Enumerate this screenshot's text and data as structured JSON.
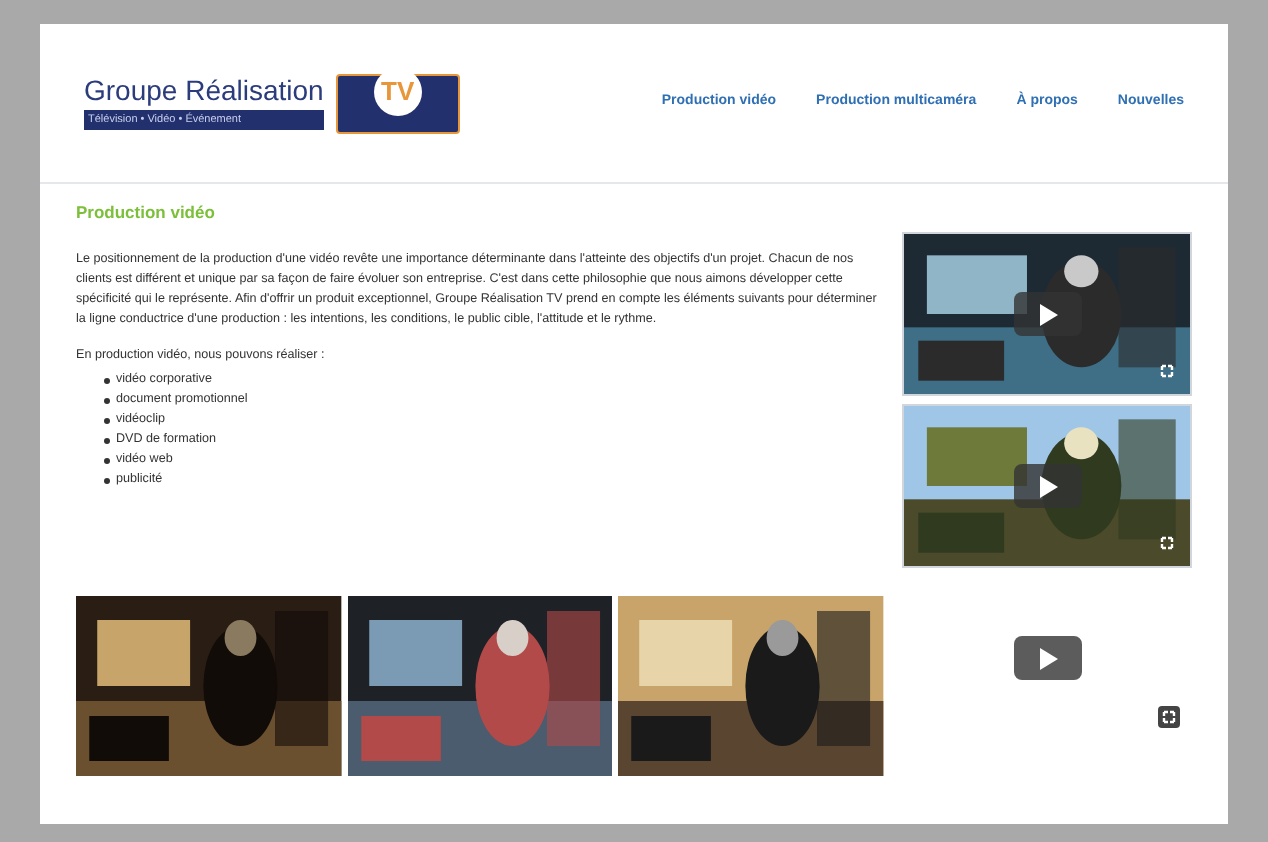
{
  "logo": {
    "name": "Groupe Réalisation",
    "tagline": "Télévision • Vidéo • Événement",
    "badge": "TV"
  },
  "nav": [
    {
      "label": "Production vidéo"
    },
    {
      "label": "Production multicaméra"
    },
    {
      "label": "À propos"
    },
    {
      "label": "Nouvelles"
    }
  ],
  "heading": "Production vidéo",
  "paragraph": "Le positionnement de la production d'une vidéo revête une importance déterminante dans l'atteinte des objectifs d'un projet. Chacun de nos clients est différent et unique par sa façon de faire évoluer son entreprise. C'est dans cette philosophie que nous aimons développer cette spécificité qui le représente. Afin d'offrir un produit exceptionnel, Groupe Réalisation TV prend en compte les éléments suivants pour déterminer la ligne conductrice d'une production : les intentions, les conditions, le public cible, l'attitude et le rythme.",
  "list_intro": "En production vidéo, nous pouvons réaliser :",
  "services": [
    "vidéo corporative",
    "document promotionnel",
    "vidéoclip",
    "DVD de formation",
    "vidéo web",
    "publicité"
  ],
  "videos": [
    {
      "kind": "picture"
    },
    {
      "kind": "picture"
    },
    {
      "kind": "blank"
    }
  ],
  "photos": [
    {
      "kind": "picture"
    },
    {
      "kind": "picture"
    },
    {
      "kind": "picture"
    }
  ]
}
